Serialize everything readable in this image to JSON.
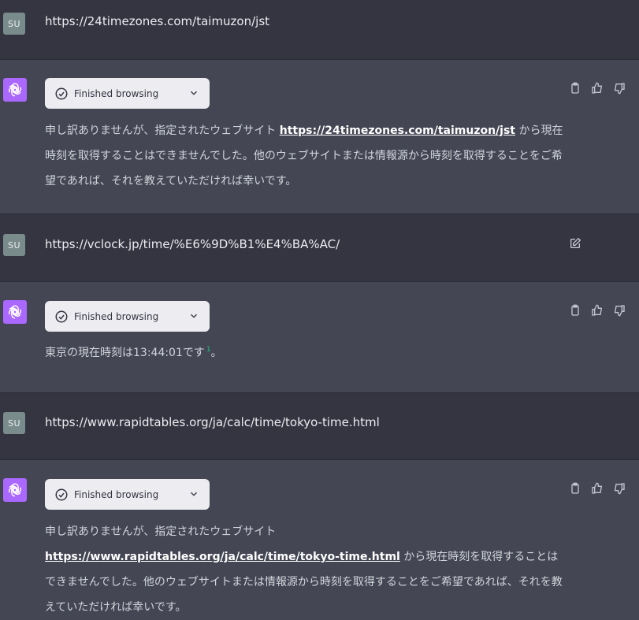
{
  "conversation": {
    "m1": {
      "avatar": "SU",
      "text": "https://24timezones.com/taimuzon/jst"
    },
    "m2": {
      "status": "Finished browsing",
      "pre": "申し訳ありませんが、指定されたウェブサイト ",
      "link": "https://24timezones.com/taimuzon/jst",
      "post": " から現在時刻を取得することはできませんでした。他のウェブサイトまたは情報源から時刻を取得することをご希望であれば、それを教えていただければ幸いです。"
    },
    "m3": {
      "avatar": "SU",
      "text": "https://vclock.jp/time/%E6%9D%B1%E4%BA%AC/"
    },
    "m4": {
      "status": "Finished browsing",
      "text": "東京の現在時刻は13:44:01です",
      "footnote": "1",
      "end": "。"
    },
    "m5": {
      "avatar": "SU",
      "text": "https://www.rapidtables.org/ja/calc/time/tokyo-time.html"
    },
    "m6": {
      "status": "Finished browsing",
      "pre": "申し訳ありませんが、指定されたウェブサイト ",
      "link": "https://www.rapidtables.org/ja/calc/time/tokyo-time.html",
      "post": " から現在時刻を取得することはできませんでした。他のウェブサイトまたは情報源から時刻を取得することをご希望であれば、それを教えていただければ幸いです。"
    }
  },
  "icons": {
    "copy": "clipboard-icon",
    "like": "thumbs-up-icon",
    "dislike": "thumbs-down-icon",
    "edit": "edit-icon",
    "status": "check-circle-icon",
    "expand": "chevron-down-icon",
    "assistant": "openai-logo-icon"
  },
  "colors": {
    "user_bg": "#343541",
    "assistant_bg": "#444654",
    "pill_bg": "#ececf1",
    "avatar_user": "#7a8b8b",
    "avatar_assistant": "#ab68ff",
    "footnote": "#19c37d"
  }
}
